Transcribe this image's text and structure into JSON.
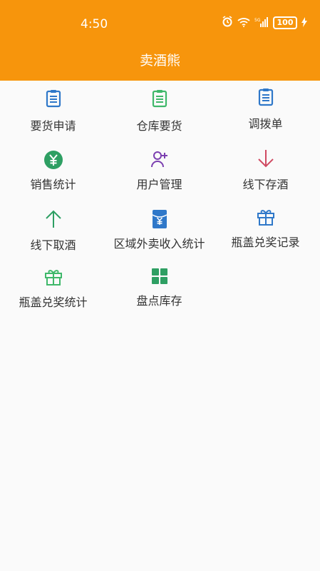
{
  "status_bar": {
    "time": "4:50",
    "battery": "100"
  },
  "header": {
    "title": "卖酒熊"
  },
  "grid": {
    "items": [
      {
        "label": "要货申请",
        "icon": "document-icon",
        "color": "#2f78c9"
      },
      {
        "label": "仓库要货",
        "icon": "document-icon",
        "color": "#3fb86a"
      },
      {
        "label": "调拨单",
        "icon": "document-icon",
        "color": "#2f78c9"
      },
      {
        "label": "销售统计",
        "icon": "yen-circle-icon",
        "color": "#2e9f63"
      },
      {
        "label": "用户管理",
        "icon": "user-add-icon",
        "color": "#7b3fb0"
      },
      {
        "label": "线下存酒",
        "icon": "arrow-down-icon",
        "color": "#d04a62"
      },
      {
        "label": "线下取酒",
        "icon": "arrow-up-icon",
        "color": "#2e9f63"
      },
      {
        "label": "区域外卖收入统计",
        "icon": "red-packet-icon",
        "color": "#2f78c9"
      },
      {
        "label": "瓶盖兑奖记录",
        "icon": "gift-icon",
        "color": "#2f78c9"
      },
      {
        "label": "瓶盖兑奖统计",
        "icon": "gift-icon",
        "color": "#3fb86a"
      },
      {
        "label": "盘点库存",
        "icon": "grid-icon",
        "color": "#2e9f63"
      }
    ]
  }
}
